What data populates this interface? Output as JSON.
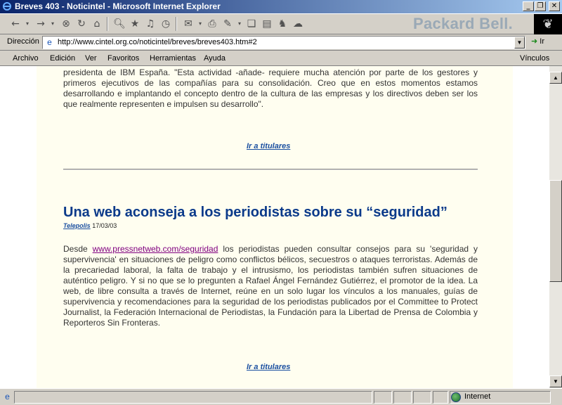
{
  "window": {
    "title": "Breves 403 - Noticintel - Microsoft Internet Explorer",
    "minimize_icon": "minimize-icon",
    "maximize_icon": "restore-icon",
    "close_icon": "close-icon"
  },
  "toolbar": {
    "buttons": [
      "back-icon",
      "forward-icon",
      "stop-icon",
      "refresh-icon",
      "home-icon",
      "search-icon",
      "favorites-icon",
      "media-icon",
      "history-icon",
      "mail-icon",
      "print-icon",
      "edit-icon",
      "discuss-icon",
      "messenger-icon",
      "research-icon"
    ],
    "brand": "Packard Bell."
  },
  "address": {
    "label": "Dirección",
    "url": "http://www.cintel.org.co/noticintel/breves/breves403.htm#2",
    "go": "Ir"
  },
  "menu": {
    "items": [
      "Archivo",
      "Edición",
      "Ver",
      "Favoritos",
      "Herramientas",
      "Ayuda"
    ],
    "links": "Vínculos"
  },
  "content": {
    "prev_paragraph": "presidenta de IBM España. \"Esta actividad -añade- requiere mucha atención por parte de los gestores y primeros ejecutivos de las compañías para su consolidación. Creo que en estos momentos estamos desarrollando e implantando el concepto dentro de la cultura de las empresas y los directivos deben ser los que realmente representen e impulsen su desarrollo\".",
    "back_to_headlines": "Ir a titulares",
    "headline": "Una web aconseja a los periodistas sobre su “seguridad”",
    "source_name": "Telepolis",
    "source_date": "17/03/03",
    "body_lead": "Desde ",
    "body_link": "www.pressnetweb.com/seguridad",
    "body_text": " los periodistas pueden consultar consejos para su 'seguridad y supervivencia' en situaciones de peligro como conflictos bélicos, secuestros o ataques terroristas. Además de la precariedad laboral, la falta de trabajo y el intrusismo, los periodistas también sufren situaciones de auténtico peligro. Y si no que se lo pregunten a Rafael Ángel Fernández Gutiérrez, el promotor de la idea. La web, de libre consulta a través de Internet, reúne en un solo lugar los vínculos a los manuales, guías de supervivencia y recomendaciones para la seguridad de los periodistas publicados por el Committee to Protect Journalist, la Federación Internacional de Periodistas, la Fundación para la Libertad de Prensa de Colombia y Reporteros Sin Fronteras.",
    "back_to_headlines_2": "Ir a titulares"
  },
  "status": {
    "zone": "Internet"
  }
}
